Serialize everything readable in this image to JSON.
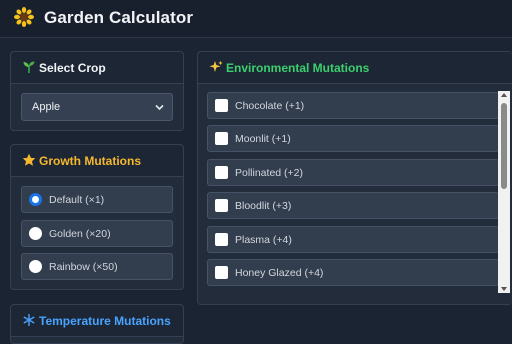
{
  "header": {
    "title": "Garden Calculator",
    "logo_icon": "sunflower-icon"
  },
  "select_crop": {
    "title": "Select Crop",
    "icon": "seedling-icon",
    "selected": "Apple"
  },
  "growth": {
    "title": "Growth Mutations",
    "icon": "star-icon",
    "title_color": "#f5b82e",
    "options": [
      {
        "label": "Default (×1)",
        "checked": true
      },
      {
        "label": "Golden (×20)",
        "checked": false
      },
      {
        "label": "Rainbow (×50)",
        "checked": false
      }
    ]
  },
  "temperature": {
    "title": "Temperature Mutations",
    "icon": "snowflake-icon",
    "title_color": "#4aa3ff"
  },
  "environmental": {
    "title": "Environmental Mutations",
    "icon": "sparkles-icon",
    "title_color": "#3ccf6e",
    "items": [
      {
        "label": "Chocolate (+1)",
        "checked": false
      },
      {
        "label": "Moonlit (+1)",
        "checked": false
      },
      {
        "label": "Pollinated (+2)",
        "checked": false
      },
      {
        "label": "Bloodlit (+3)",
        "checked": false
      },
      {
        "label": "Plasma (+4)",
        "checked": false
      },
      {
        "label": "Honey Glazed (+4)",
        "checked": false
      }
    ]
  }
}
